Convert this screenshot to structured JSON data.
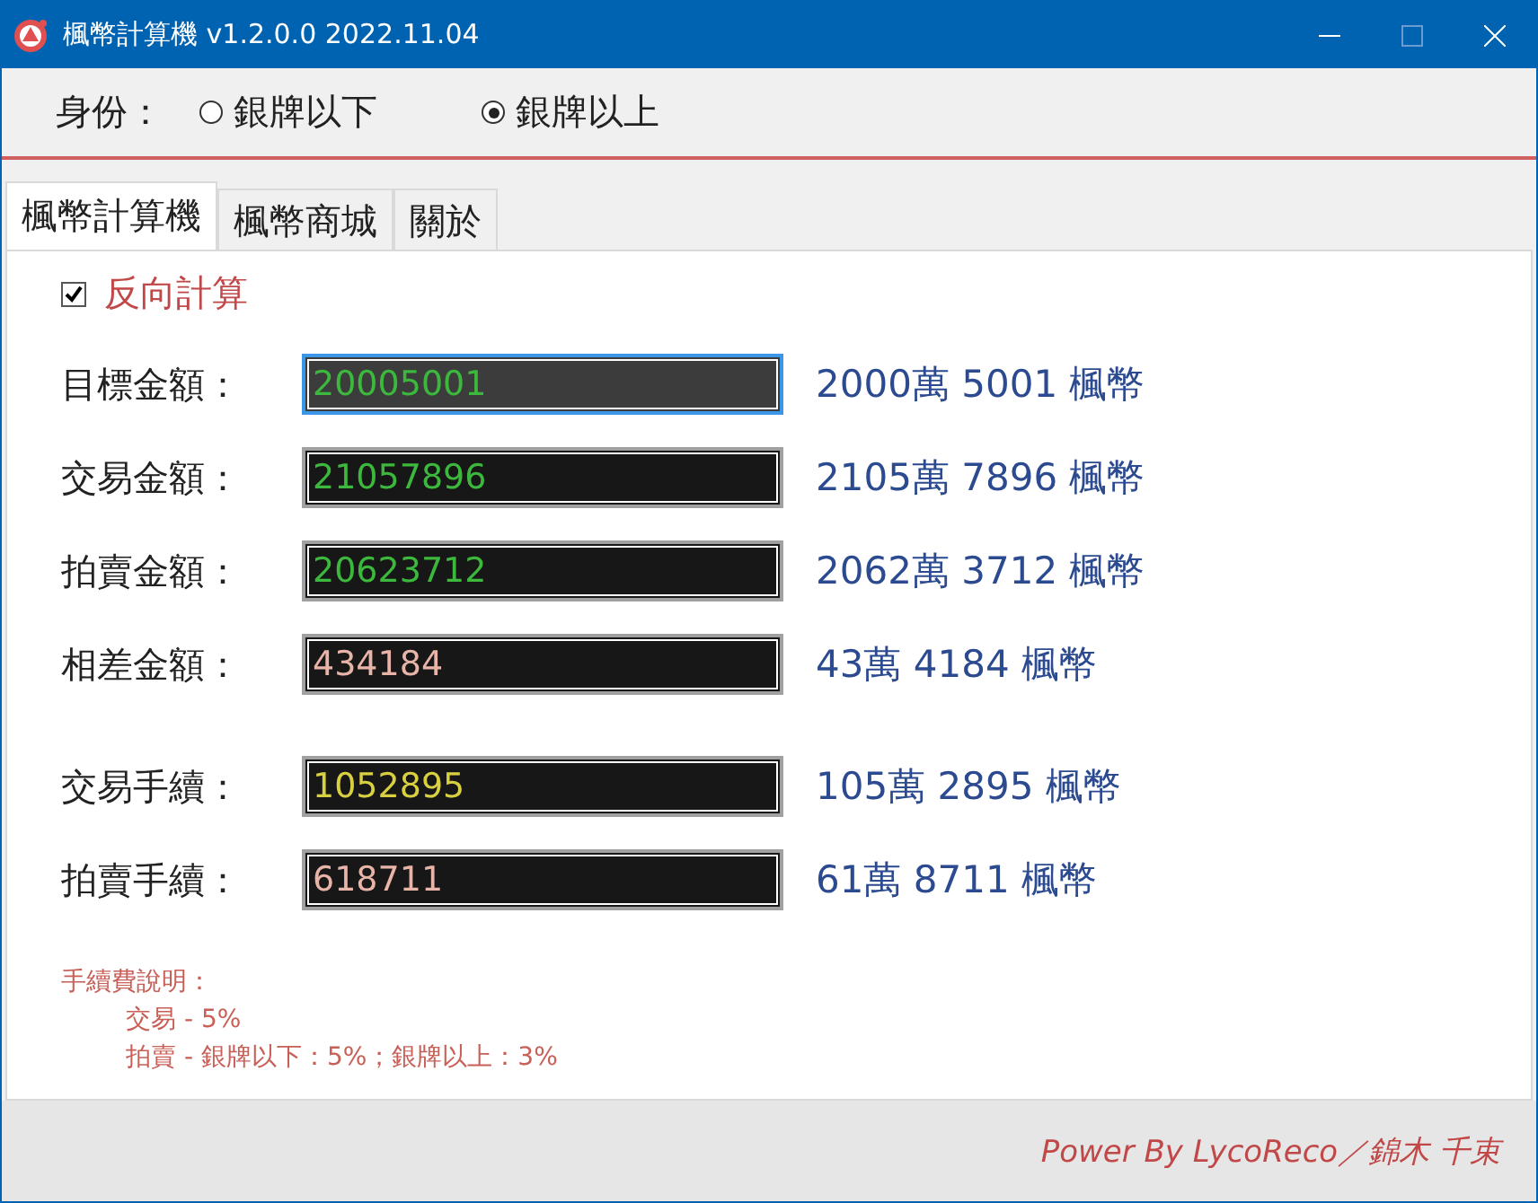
{
  "window": {
    "title": "楓幣計算機 v1.2.0.0 2022.11.04",
    "maximize_disabled": true
  },
  "identity": {
    "label": "身份：",
    "options": [
      {
        "label": "銀牌以下",
        "selected": false
      },
      {
        "label": "銀牌以上",
        "selected": true
      }
    ]
  },
  "tabs": [
    {
      "label": "楓幣計算機",
      "selected": true
    },
    {
      "label": "楓幣商城",
      "selected": false
    },
    {
      "label": "關於",
      "selected": false
    }
  ],
  "reverse": {
    "label": "反向計算",
    "checked": true
  },
  "amounts": [
    {
      "label": "目標金額：",
      "value": "20005001",
      "color": "#3cb83c",
      "focused": true,
      "reading": "2000萬 5001 楓幣"
    },
    {
      "label": "交易金額：",
      "value": "21057896",
      "color": "#3cb83c",
      "focused": false,
      "reading": "2105萬 7896 楓幣"
    },
    {
      "label": "拍賣金額：",
      "value": "20623712",
      "color": "#3cb83c",
      "focused": false,
      "reading": "2062萬 3712 楓幣"
    },
    {
      "label": "相差金額：",
      "value": "434184",
      "color": "#e8b4a8",
      "focused": false,
      "reading": "43萬 4184 楓幣"
    }
  ],
  "fees": [
    {
      "label": "交易手續：",
      "value": "1052895",
      "color": "#d8d040",
      "focused": false,
      "reading": "105萬 2895 楓幣"
    },
    {
      "label": "拍賣手續：",
      "value": "618711",
      "color": "#e8b4a8",
      "focused": false,
      "reading": "61萬 8711 楓幣"
    }
  ],
  "notes": {
    "heading": "手續費說明：",
    "lines": [
      "交易 - 5%",
      "拍賣 - 銀牌以下：5%；銀牌以上：3%"
    ]
  },
  "footer": "Power By LycoReco／錦木 千束"
}
